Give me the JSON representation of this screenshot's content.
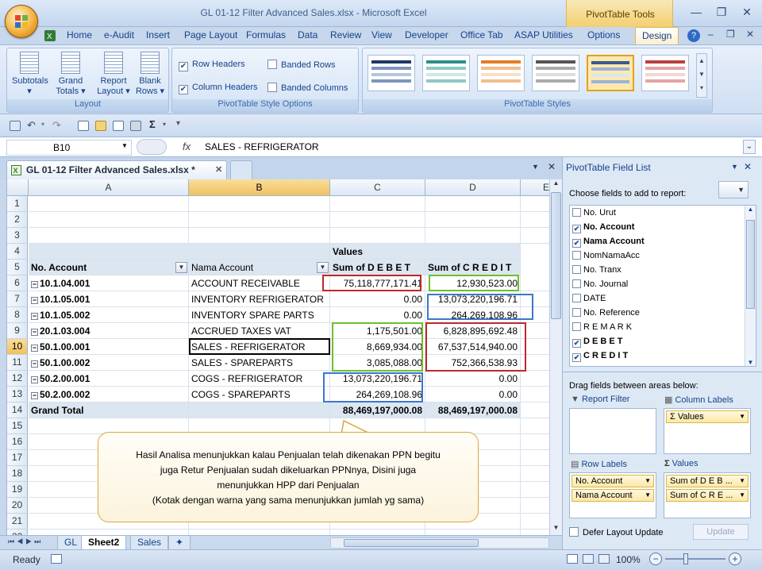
{
  "window": {
    "title": "GL 01-12 Filter Advanced Sales.xlsx - Microsoft Excel",
    "context_tab": "PivotTable Tools"
  },
  "ribbon_tabs": [
    "Home",
    "e-Audit",
    "Insert",
    "Page Layout",
    "Formulas",
    "Data",
    "Review",
    "View",
    "Developer",
    "Office Tab",
    "ASAP Utilities",
    "Options",
    "Design"
  ],
  "ribbon": {
    "layout": {
      "label": "Layout",
      "buttons": [
        {
          "label1": "Subtotals",
          "label2": "▾"
        },
        {
          "label1": "Grand",
          "label2": "Totals ▾"
        },
        {
          "label1": "Report",
          "label2": "Layout ▾"
        },
        {
          "label1": "Blank",
          "label2": "Rows ▾"
        }
      ]
    },
    "style_options": {
      "label": "PivotTable Style Options",
      "row_headers": "Row Headers",
      "column_headers": "Column Headers",
      "banded_rows": "Banded Rows",
      "banded_columns": "Banded Columns"
    },
    "styles": {
      "label": "PivotTable Styles"
    }
  },
  "formula_bar": {
    "name_box": "B10",
    "fx": "fx",
    "formula": "SALES - REFRIGERATOR"
  },
  "workbook_tab": "GL 01-12 Filter Advanced Sales.xlsx *",
  "columns": [
    "A",
    "B",
    "C",
    "D",
    "E"
  ],
  "rows": [
    "1",
    "2",
    "3",
    "4",
    "5",
    "6",
    "7",
    "8",
    "9",
    "10",
    "11",
    "12",
    "13",
    "14",
    "15",
    "16",
    "17",
    "18",
    "19",
    "20",
    "21",
    "22"
  ],
  "pivot": {
    "values_label": "Values",
    "header_account": "No. Account",
    "header_name": "Nama Account",
    "header_debet": "Sum of D E B E T",
    "header_credit": "Sum of C R E D I T",
    "data": [
      {
        "acc": "10.1.04.001",
        "name": "ACCOUNT RECEIVABLE",
        "debet": "75,118,777,171.41",
        "credit": "12,930,523.00"
      },
      {
        "acc": "10.1.05.001",
        "name": "INVENTORY REFRIGERATOR",
        "debet": "0.00",
        "credit": "13,073,220,196.71"
      },
      {
        "acc": "10.1.05.002",
        "name": "INVENTORY SPARE PARTS",
        "debet": "0.00",
        "credit": "264,269,108.96"
      },
      {
        "acc": "20.1.03.004",
        "name": "ACCRUED TAXES VAT",
        "debet": "1,175,501.00",
        "credit": "6,828,895,692.48"
      },
      {
        "acc": "50.1.00.001",
        "name": "SALES - REFRIGERATOR",
        "debet": "8,669,934.00",
        "credit": "67,537,514,940.00"
      },
      {
        "acc": "50.1.00.002",
        "name": "SALES - SPAREPARTS",
        "debet": "3,085,088.00",
        "credit": "752,366,538.93"
      },
      {
        "acc": "50.2.00.001",
        "name": "COGS - REFRIGERATOR",
        "debet": "13,073,220,196.71",
        "credit": "0.00"
      },
      {
        "acc": "50.2.00.002",
        "name": "COGS - SPAREPARTS",
        "debet": "264,269,108.96",
        "credit": "0.00"
      }
    ],
    "grand_total_label": "Grand Total",
    "grand_total_debet": "88,469,197,000.08",
    "grand_total_credit": "88,469,197,000.08"
  },
  "callout": {
    "line1": "Hasil Analisa menunjukkan kalau Penjualan telah dikenakan PPN begitu",
    "line2": "juga Retur Penjualan sudah dikeluarkan PPNnya, Disini juga",
    "line3": "menunjukkan HPP dari Penjualan",
    "line4": "(Kotak dengan warna yang sama menunjukkan jumlah yg sama)"
  },
  "sheet_tabs": [
    "GL",
    "Sheet2",
    "Sales"
  ],
  "status": {
    "ready": "Ready",
    "zoom": "100%"
  },
  "field_list": {
    "title": "PivotTable Field List",
    "choose_label": "Choose fields to add to report:",
    "fields": [
      {
        "name": "No. Urut",
        "checked": false
      },
      {
        "name": "No. Account",
        "checked": true
      },
      {
        "name": "Nama Account",
        "checked": true
      },
      {
        "name": "NomNamaAcc",
        "checked": false
      },
      {
        "name": "No. Tranx",
        "checked": false
      },
      {
        "name": "No. Journal",
        "checked": false
      },
      {
        "name": "DATE",
        "checked": false
      },
      {
        "name": "No. Reference",
        "checked": false
      },
      {
        "name": "R E M A R K",
        "checked": false
      },
      {
        "name": "D E B E T",
        "checked": true
      },
      {
        "name": "C R E D I T",
        "checked": true
      }
    ],
    "drag_label": "Drag fields between areas below:",
    "report_filter": "Report Filter",
    "column_labels": "Column Labels",
    "column_item": "Values",
    "row_labels": "Row Labels",
    "values": "Values",
    "row_items": [
      "No. Account",
      "Nama Account"
    ],
    "value_items": [
      "Sum of D E B ...",
      "Sum of C R E ..."
    ],
    "defer": "Defer Layout Update",
    "update": "Update"
  },
  "colors": {
    "red": "#c0272d",
    "green": "#6fbf2a",
    "blue": "#3c78c8",
    "black": "#000000"
  }
}
